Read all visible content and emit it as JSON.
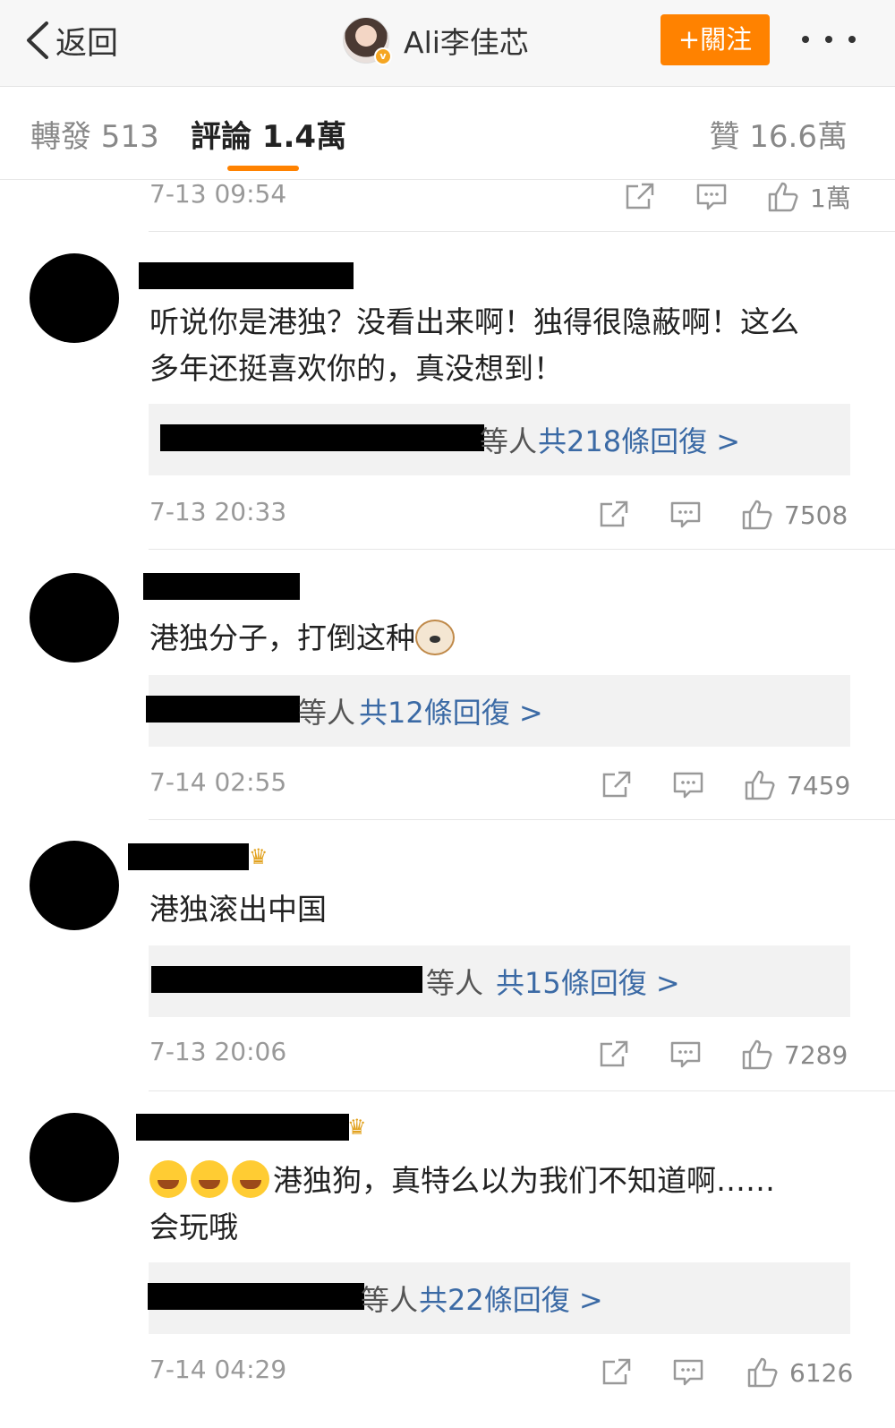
{
  "nav": {
    "back_label": "返回",
    "profile_name": "Ali李佳芯",
    "follow_label": "+關注"
  },
  "tabs": {
    "repost": "轉發 513",
    "comments": "評論 1.4萬",
    "likes": "贊 16.6萬"
  },
  "top_meta": {
    "time": "7-13 09:54",
    "likes": "1萬"
  },
  "comments": [
    {
      "text": "听说你是港独？没看出来啊！独得很隐蔽啊！这么\n多年还挺喜欢你的，真没想到！",
      "reply_who": "等人",
      "reply_count": "共218條回復 >",
      "time": "7-13 20:33",
      "likes": "7508"
    },
    {
      "text": "港独分子，打倒这种",
      "reply_who": "等人",
      "reply_count": "共12條回復 >",
      "time": "7-14 02:55",
      "likes": "7459"
    },
    {
      "text": "港独滚出中国",
      "reply_who": "等人",
      "reply_count": "共15條回復 >",
      "time": "7-13 20:06",
      "likes": "7289"
    },
    {
      "text": "港独狗，真特么以为我们不知道啊……\n会玩哦",
      "reply_who": "等人",
      "reply_count": "共22條回復 >",
      "time": "7-14 04:29",
      "likes": "6126"
    }
  ],
  "colors": {
    "accent": "#ff8200",
    "link": "#3b6aa5",
    "reply_bg": "#f2f2f2"
  },
  "icons": [
    "chevron-left-icon",
    "verified-badge-icon",
    "more-dots-icon",
    "repost-icon",
    "comment-icon",
    "thumbs-up-icon",
    "crown-icon",
    "laughing-emoji-icon",
    "dog-emoji-icon"
  ]
}
